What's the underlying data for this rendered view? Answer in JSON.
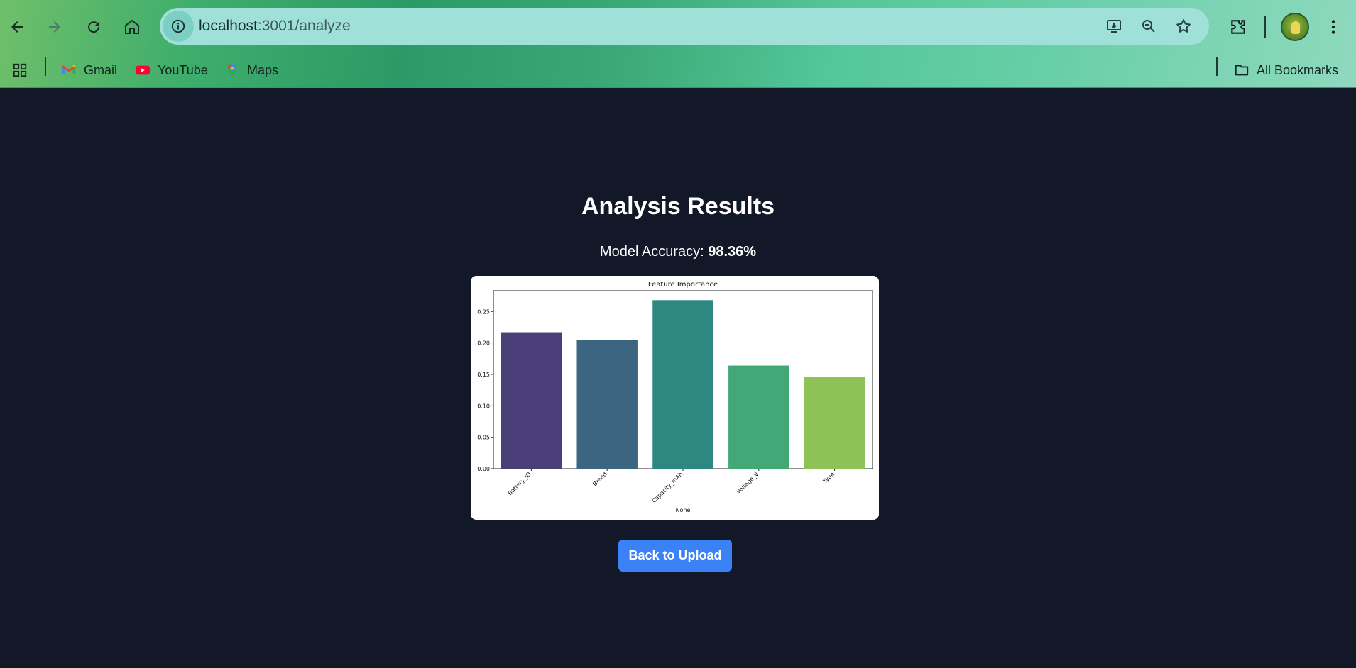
{
  "browser": {
    "url_host": "localhost",
    "url_path": ":3001/analyze",
    "bookmarks": [
      {
        "label": "Gmail",
        "icon": "gmail-icon"
      },
      {
        "label": "YouTube",
        "icon": "youtube-icon"
      },
      {
        "label": "Maps",
        "icon": "maps-icon"
      }
    ],
    "all_bookmarks_label": "All Bookmarks"
  },
  "page": {
    "title": "Analysis Results",
    "accuracy_label": "Model Accuracy: ",
    "accuracy_value": "98.36%",
    "back_button_label": "Back to Upload"
  },
  "chart_data": {
    "type": "bar",
    "title": "Feature Importance",
    "xlabel": "None",
    "ylabel": "",
    "categories": [
      "Battery_ID",
      "Brand",
      "Capacity_mAh",
      "Voltage_V",
      "Type"
    ],
    "values": [
      0.217,
      0.205,
      0.268,
      0.164,
      0.146
    ],
    "colors": [
      "#4a3f78",
      "#3b6580",
      "#2f8781",
      "#42a877",
      "#8dc356"
    ],
    "ylim": [
      0,
      0.283
    ],
    "yticks": [
      "0.00",
      "0.05",
      "0.10",
      "0.15",
      "0.20",
      "0.25"
    ],
    "grid": false
  }
}
